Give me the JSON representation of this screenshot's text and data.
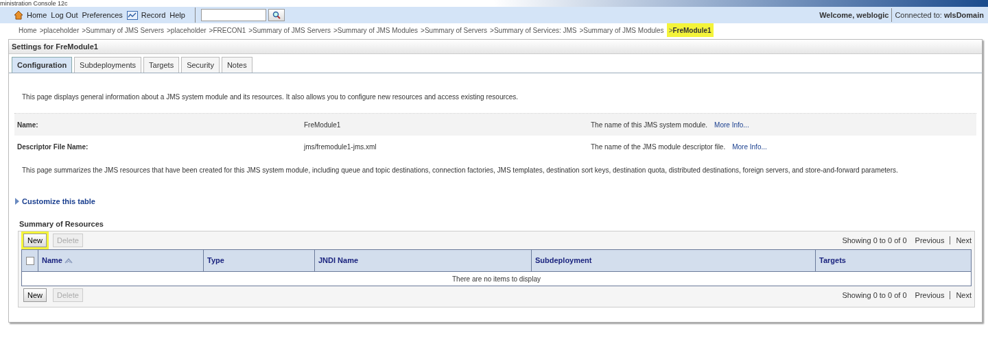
{
  "window": {
    "title": "ministration Console 12c"
  },
  "toolbar": {
    "links": [
      {
        "kind": "home",
        "label": "Home"
      },
      {
        "kind": "plain",
        "label": "Log Out"
      },
      {
        "kind": "plain",
        "label": "Preferences"
      },
      {
        "kind": "record",
        "label": "Record"
      },
      {
        "kind": "plain",
        "label": "Help"
      }
    ],
    "welcome": "Welcome, weblogic",
    "connected_label": "Connected to:",
    "domain": "wlsDomain"
  },
  "breadcrumbs": [
    {
      "label": "Home",
      "current": false,
      "highlighted": false
    },
    {
      "label": "placeholder",
      "current": false,
      "highlighted": false
    },
    {
      "label": "Summary of JMS Servers",
      "current": false,
      "highlighted": false
    },
    {
      "label": "placeholder",
      "current": false,
      "highlighted": false
    },
    {
      "label": "FRECON1",
      "current": false,
      "highlighted": false
    },
    {
      "label": "Summary of JMS Servers",
      "current": false,
      "highlighted": false
    },
    {
      "label": "Summary of JMS Modules",
      "current": false,
      "highlighted": false
    },
    {
      "label": "Summary of Servers",
      "current": false,
      "highlighted": false
    },
    {
      "label": "Summary of Services: JMS",
      "current": false,
      "highlighted": false
    },
    {
      "label": "Summary of JMS Modules",
      "current": false,
      "highlighted": false
    },
    {
      "label": "FreModule1",
      "current": true,
      "highlighted": true
    }
  ],
  "breadcrumb_separator": ">",
  "panel": {
    "title": "Settings for FreModule1",
    "tabs": [
      {
        "label": "Configuration",
        "selected": true
      },
      {
        "label": "Subdeployments",
        "selected": false
      },
      {
        "label": "Targets",
        "selected": false
      },
      {
        "label": "Security",
        "selected": false
      },
      {
        "label": "Notes",
        "selected": false
      }
    ],
    "intro": "This page displays general information about a JMS system module and its resources. It also allows you to configure new resources and access existing resources.",
    "fields": [
      {
        "label": "Name:",
        "value": "FreModule1",
        "help": "The name of this JMS system module.",
        "more": "More Info..."
      },
      {
        "label": "Descriptor File Name:",
        "value": "jms/fremodule1-jms.xml",
        "help": "The name of the JMS module descriptor file.",
        "more": "More Info..."
      }
    ],
    "summary": "This page summarizes the JMS resources that have been created for this JMS system module, including queue and topic destinations, connection factories, JMS templates, destination sort keys, destination quota, distributed destinations, foreign servers, and store-and-forward parameters.",
    "customize": {
      "label": "Customize this table",
      "expanded": false
    },
    "table": {
      "title": "Summary of Resources",
      "top_buttons": [
        {
          "label": "New",
          "disabled": false,
          "highlighted": true
        },
        {
          "label": "Delete",
          "disabled": true,
          "highlighted": false
        }
      ],
      "bottom_buttons": [
        {
          "label": "New",
          "disabled": false,
          "highlighted": false
        },
        {
          "label": "Delete",
          "disabled": true,
          "highlighted": false
        }
      ],
      "paging": {
        "showing": "Showing 0 to 0 of 0",
        "previous": "Previous",
        "next": "Next"
      },
      "bottom_paging": {
        "showing": "Showing 0 to 0 of 0",
        "previous": "Previous",
        "next": "Next"
      },
      "select_all": {
        "checked": false
      },
      "columns": [
        {
          "label": "Name",
          "sorted": true
        },
        {
          "label": "Type",
          "sorted": false
        },
        {
          "label": "JNDI Name",
          "sorted": false
        },
        {
          "label": "Subdeployment",
          "sorted": false
        },
        {
          "label": "Targets",
          "sorted": false
        }
      ],
      "empty": "There are no items to display"
    }
  }
}
